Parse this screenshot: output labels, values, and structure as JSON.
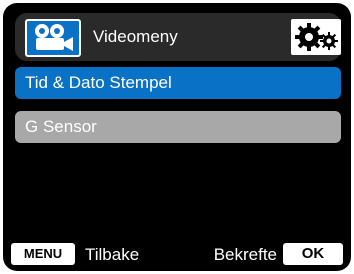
{
  "header": {
    "title": "Videomeny",
    "left_icon": "video-camera-icon",
    "right_icon": "settings-gears-icon"
  },
  "menu": {
    "items": [
      {
        "label": "Tid & Dato Stempel",
        "selected": true
      },
      {
        "label": "G Sensor",
        "selected": false
      }
    ]
  },
  "footer": {
    "menu_button_label": "MENU",
    "back_label": "Tilbake",
    "confirm_label": "Bekrefte",
    "ok_button_label": "OK"
  },
  "colors": {
    "accent": "#0a72c6",
    "screen_bg": "#000000",
    "header_bg": "#2a2a2a",
    "unselected_item": "#a8a8a8"
  }
}
